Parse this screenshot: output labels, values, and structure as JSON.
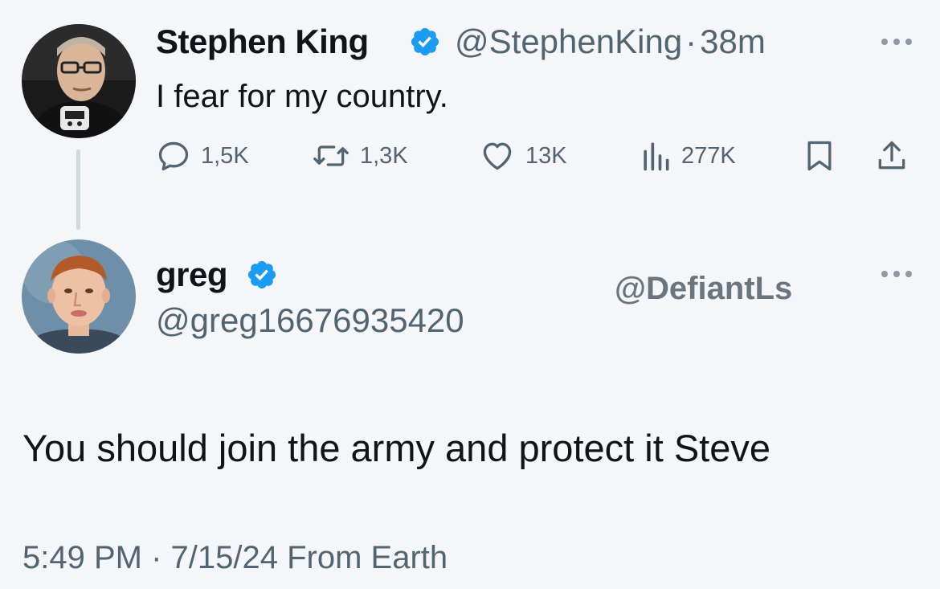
{
  "original_tweet": {
    "author_name": "Stephen King",
    "handle": "@StephenKing",
    "separator": "·",
    "time_ago": "38m",
    "text": "I fear for my country.",
    "actions": {
      "replies": "1,5K",
      "retweets": "1,3K",
      "likes": "13K",
      "views": "277K"
    }
  },
  "reply_tweet": {
    "author_name": "greg",
    "handle": "@greg16676935420",
    "text": "You should join the army and protect it Steve",
    "timestamp": "5:49 PM · 7/15/24 From Earth"
  },
  "watermark": "@DefiantLs",
  "colors": {
    "background": "#f4f6fa",
    "text_primary": "#0f1419",
    "text_secondary": "#536471",
    "verified_badge": "#1d9bf0",
    "thread_line": "#cfd9de"
  },
  "icons": [
    "verified-badge-icon",
    "more-options-icon",
    "reply-icon",
    "retweet-icon",
    "like-icon",
    "views-icon",
    "bookmark-icon",
    "share-icon"
  ]
}
